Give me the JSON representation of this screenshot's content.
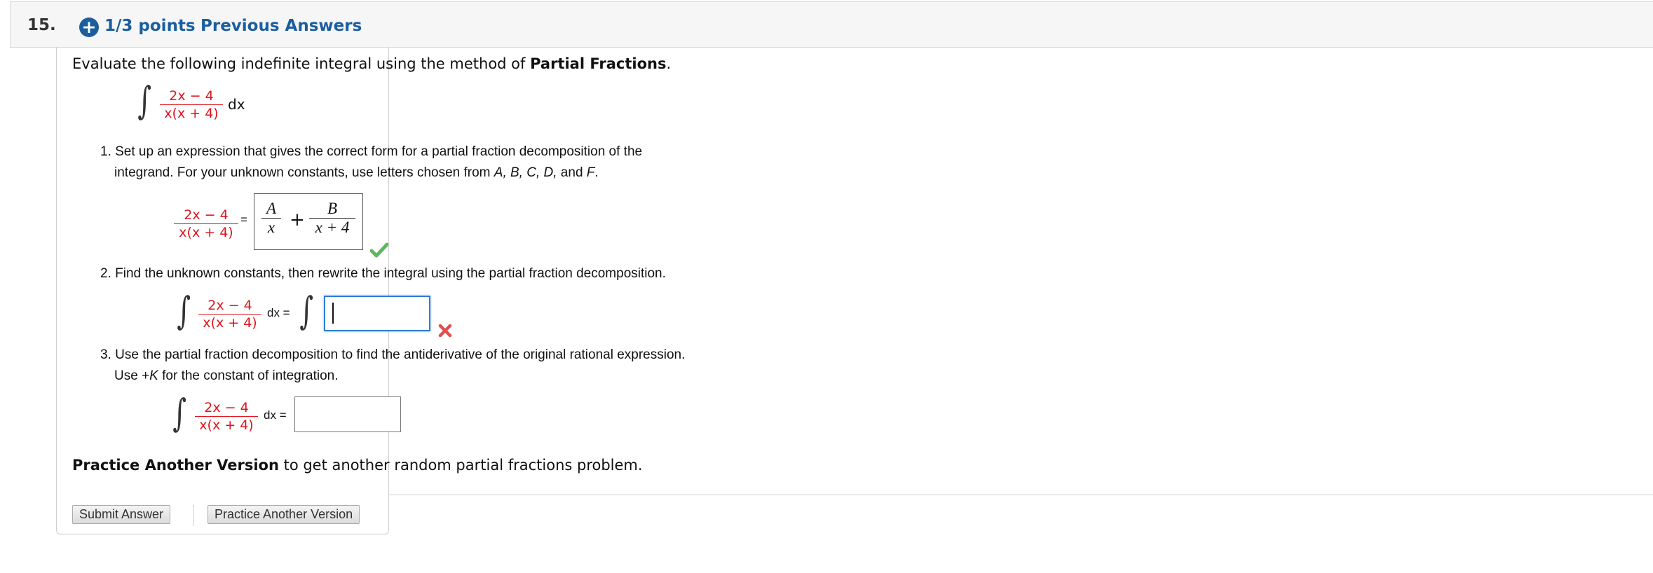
{
  "header": {
    "number": "15.",
    "points": "1/3 points",
    "previous_answers": "Previous Answers"
  },
  "intro": {
    "text": "Evaluate the following indefinite integral using the method of ",
    "bold": "Partial Fractions",
    "end": "."
  },
  "integrand": {
    "numerator": "2x − 4",
    "denominator": "x(x + 4)",
    "dx": "dx"
  },
  "step1": {
    "line1": "1. Set up an expression that gives the correct form for a partial fraction decomposition of the",
    "line2_pre": "integrand. For your unknown constants, use letters chosen from ",
    "line2_letters": "A, B, C, D,",
    "line2_and": " and ",
    "line2_last": "F",
    "line2_end": ".",
    "equals": "=",
    "answer": {
      "num1": "A",
      "den1": "x",
      "plus": "+",
      "num2": "B",
      "den2": "x + 4"
    },
    "status": "correct"
  },
  "step2": {
    "text": "2. Find the unknown constants, then rewrite the integral using the partial fraction decomposition.",
    "dx_equals": "dx =",
    "input_value": "",
    "status": "incorrect"
  },
  "step3": {
    "line1": "3. Use the partial fraction decomposition to find the antiderivative of the original rational expression.",
    "line2_pre": "Use +",
    "line2_k": "K",
    "line2_post": " for the constant of integration.",
    "dx_equals": "dx =",
    "input_value": ""
  },
  "practice": {
    "bold": "Practice Another Version",
    "rest": " to get another random partial fractions problem."
  },
  "buttons": {
    "submit": "Submit Answer",
    "practice": "Practice Another Version"
  },
  "colors": {
    "accent": "#1b5e9e",
    "integrand_red": "#e0141e",
    "correct_green": "#5cb85c",
    "incorrect_red": "#e05050"
  }
}
